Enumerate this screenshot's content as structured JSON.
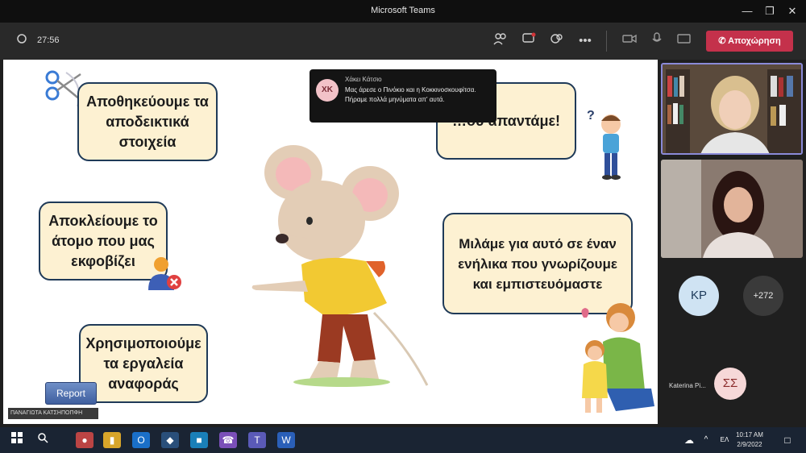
{
  "window": {
    "title": "Microsoft Teams"
  },
  "toolbar": {
    "timer": "27:56",
    "leave_label": "Αποχώρηση",
    "leave_color": "#c4314b"
  },
  "slide": {
    "cards": [
      "Αποθηκεύουμε τα αποδεικτικά στοιχεία",
      "…ου απαντάμε!",
      "Αποκλείουμε το άτομο που μας εκφοβίζει",
      "Μιλάμε για αυτό σε έναν ενήλικα που γνωρίζουμε και εμπιστευόμαστε",
      "Χρησιμοποιούμε τα εργαλεία αναφοράς"
    ],
    "report_label": "Report",
    "card_bg": "#fdf1d2",
    "card_border": "#1f3a58"
  },
  "chat_toast": {
    "initials": "XK",
    "sender": "Χάκει Κάτσιο",
    "message": "Μας άρεσε ο Πινόκιο και η Κοκκινοσκουφίτσα. Πήραμε πολλά μηνύματα απ' αυτά."
  },
  "presenter_label": "ΠΑΝΑΓΙΩΤΑ ΚΑΤΣΗΠΟΠΦΗ",
  "participants": {
    "kp_initials": "KP",
    "kp_name": "Katerina Pi...",
    "overflow_count": "+272",
    "ss_initials": "ΣΣ"
  },
  "taskbar": {
    "lang": "ΕΛ",
    "time": "10:17 AM",
    "date": "2/9/2022"
  },
  "icons": [
    "windows-icon",
    "search-icon",
    "chrome-icon",
    "file-explorer-icon",
    "outlook-icon",
    "python-icon",
    "store-icon",
    "viber-icon",
    "teams-icon",
    "word-icon"
  ]
}
